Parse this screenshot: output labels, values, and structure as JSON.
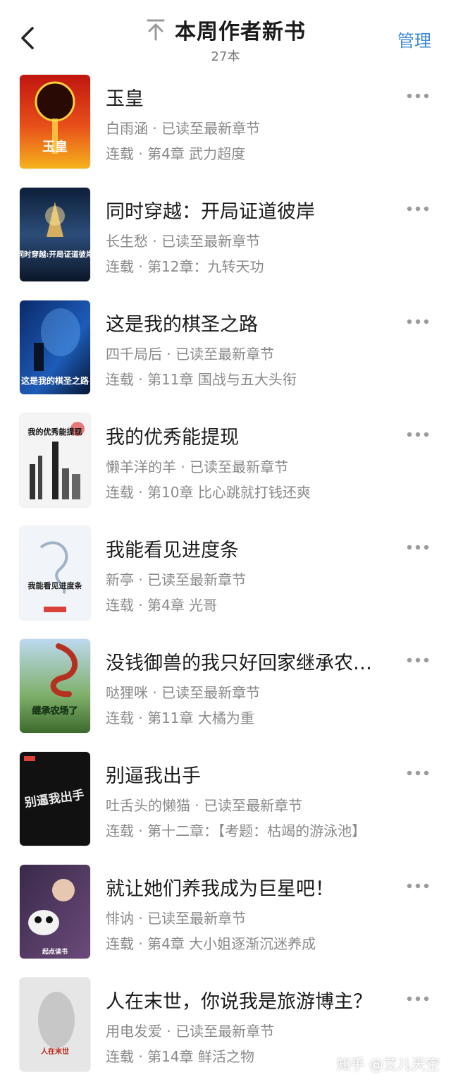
{
  "header": {
    "title": "本周作者新书",
    "count": "27本",
    "manage_label": "管理"
  },
  "books": [
    {
      "title": "玉皇",
      "author_line": "白雨涵 · 已读至最新章节",
      "chapter_line": "连载 · 第4章 武力超度",
      "cover_text": "玉皇"
    },
    {
      "title": "同时穿越：开局证道彼岸",
      "author_line": "长生愁 · 已读至最新章节",
      "chapter_line": "连载 · 第12章：九转天功",
      "cover_text": "同时穿越:开局证道彼岸"
    },
    {
      "title": "这是我的棋圣之路",
      "author_line": "四千局后 · 已读至最新章节",
      "chapter_line": "连载 · 第11章 国战与五大头衔",
      "cover_text": "这是我的棋圣之路"
    },
    {
      "title": "我的优秀能提现",
      "author_line": "懒羊洋的羊 · 已读至最新章节",
      "chapter_line": "连载 · 第10章 比心跳就打钱还爽",
      "cover_text": "我的优秀能提现"
    },
    {
      "title": "我能看见进度条",
      "author_line": "新亭 · 已读至最新章节",
      "chapter_line": "连载 · 第4章 光哥",
      "cover_text": "我能看见进度条"
    },
    {
      "title": "没钱御兽的我只好回家继承农…",
      "author_line": "哒狸咪 · 已读至最新章节",
      "chapter_line": "连载 · 第11章 大橘为重",
      "cover_text": "继承农场了"
    },
    {
      "title": "别逼我出手",
      "author_line": "吐舌头的懒猫 · 已读至最新章节",
      "chapter_line": "连载 · 第十二章：【考题：枯竭的游泳池】",
      "cover_text": "别逼我出手"
    },
    {
      "title": "就让她们养我成为巨星吧！",
      "author_line": "悱讷 · 已读至最新章节",
      "chapter_line": "连载 · 第4章 大小姐逐渐沉迷养成",
      "cover_text": "起点读书"
    },
    {
      "title": "人在末世，你说我是旅游博主？",
      "author_line": "用电发爱 · 已读至最新章节",
      "chapter_line": "连载 · 第14章 鲜活之物",
      "cover_text": "人在末世"
    }
  ],
  "watermark": "知乎 @艾儿天空",
  "colors": {
    "accent": "#3d8bd6",
    "meta": "#8a8a8a"
  }
}
